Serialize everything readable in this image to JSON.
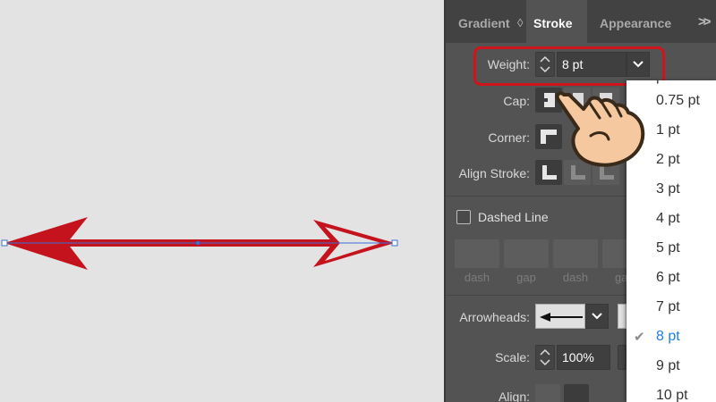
{
  "panel": {
    "tabs": [
      {
        "label": "Gradient",
        "active": false
      },
      {
        "label": "Stroke",
        "active": true
      },
      {
        "label": "Appearance",
        "active": false
      }
    ],
    "more_icon": "double-chevron-right-icon",
    "weight": {
      "label": "Weight:",
      "value": "8 pt"
    },
    "cap": {
      "label": "Cap:"
    },
    "corner": {
      "label": "Corner:"
    },
    "align_stroke": {
      "label": "Align Stroke:"
    },
    "dashed_line": {
      "label": "Dashed Line",
      "checked": false
    },
    "dash_fields": [
      "dash",
      "gap",
      "dash",
      "ga"
    ],
    "arrowheads": {
      "label": "Arrowheads:"
    },
    "scale": {
      "label": "Scale:",
      "value": "100%"
    },
    "align": {
      "label": "Align:"
    }
  },
  "weight_dropdown": {
    "options": [
      "0.75 pt",
      "1 pt",
      "2 pt",
      "3 pt",
      "4 pt",
      "5 pt",
      "6 pt",
      "7 pt",
      "8 pt",
      "9 pt",
      "10 pt"
    ],
    "selected": "8 pt",
    "partial_top_option": "pt"
  },
  "colors": {
    "accent_blue": "#1e7fe0",
    "highlight_red": "#d0141c",
    "arrow_red": "#c4131d"
  }
}
